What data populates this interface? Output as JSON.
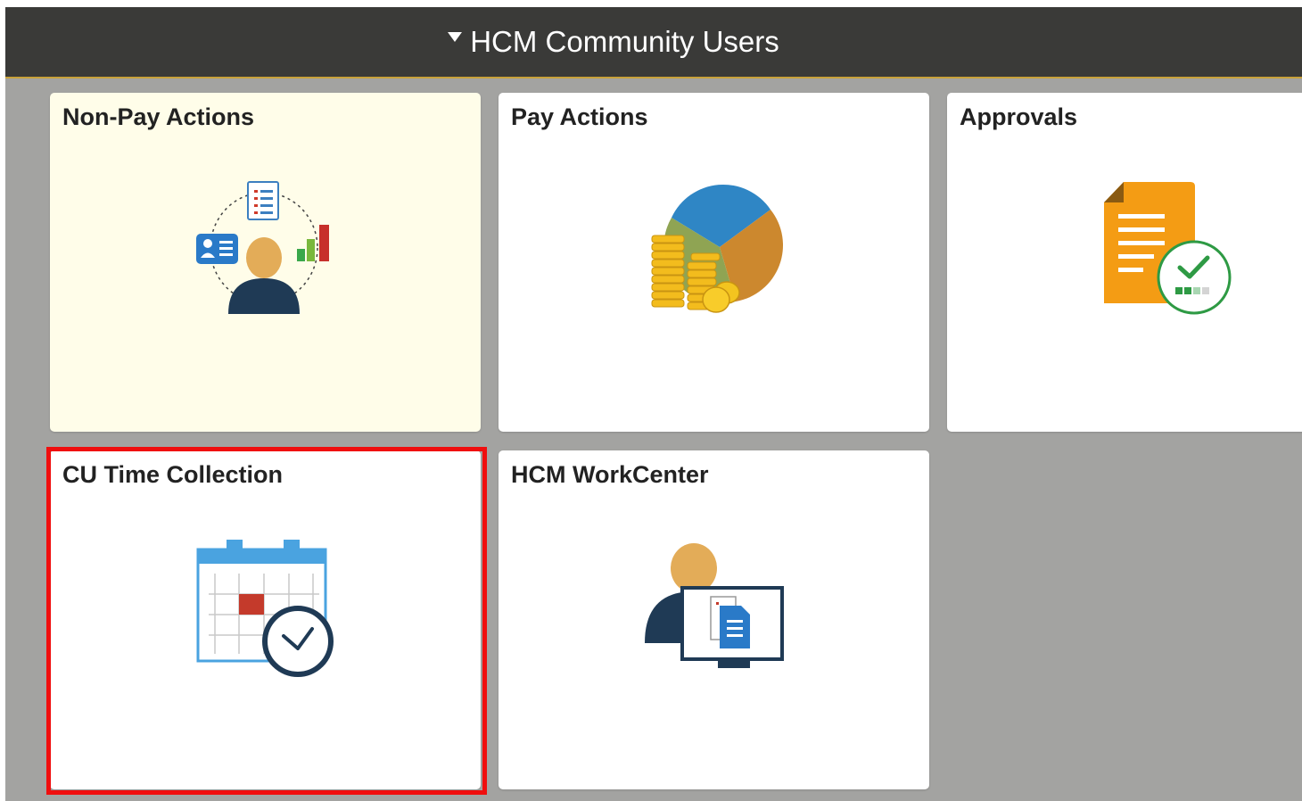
{
  "header": {
    "title": "HCM Community Users"
  },
  "tiles": [
    {
      "title": "Non-Pay Actions",
      "icon": "employee-actions-icon",
      "state": "active"
    },
    {
      "title": "Pay Actions",
      "icon": "pie-chart-coins-icon"
    },
    {
      "title": "Approvals",
      "icon": "document-approval-icon"
    },
    {
      "title": "CU Time Collection",
      "icon": "calendar-clock-icon",
      "state": "highlighted"
    },
    {
      "title": "HCM WorkCenter",
      "icon": "person-monitor-icon"
    }
  ],
  "colors": {
    "header_bg": "#3a3a38",
    "page_bg": "#a3a3a1",
    "active_tile_bg": "#fffde9",
    "highlight_border": "#f00e0e"
  }
}
